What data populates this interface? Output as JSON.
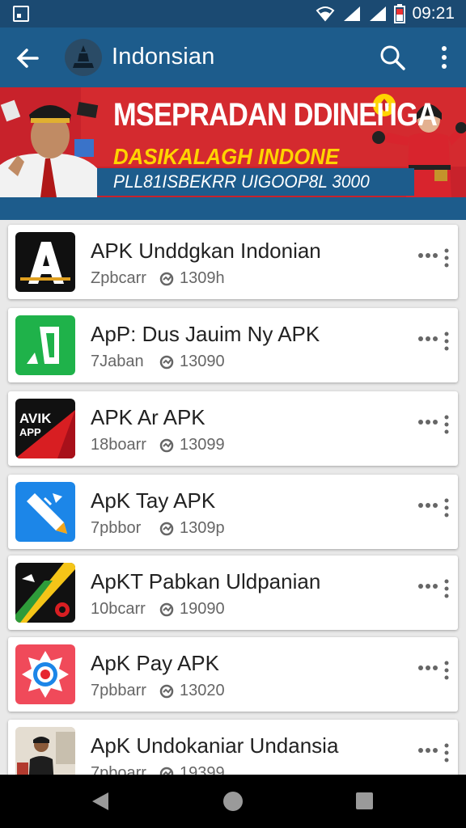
{
  "status_bar": {
    "time": "09:21",
    "icons": [
      "screen-cast-icon",
      "wifi-icon",
      "signal-icon",
      "signal-icon",
      "battery-icon"
    ]
  },
  "app_bar": {
    "title": "Indonsian",
    "icons": [
      "back-arrow-icon",
      "app-logo",
      "search-icon",
      "more-vert-icon"
    ]
  },
  "banner": {
    "line1": "MSEPRADAN DDINEI'IGA",
    "line2": "DASIKALAGH INDONE",
    "line3": "PLL81ISBEKRR UIGOOP8L 3000",
    "colors": {
      "background": "#c8222b",
      "strip": "#1d5c8c",
      "headline2": "#ffd400"
    }
  },
  "apps": [
    {
      "title": "APK Unddgkan Indonian",
      "subtitle": "Zpbcarr",
      "count": "1309h",
      "icon": "letter-a-icon"
    },
    {
      "title": "ApP: Dus Jauim Ny APK",
      "subtitle": "7Jaban",
      "count": "13090",
      "icon": "green-d-icon"
    },
    {
      "title": "APK Ar APK",
      "subtitle": "18boarr",
      "count": "13099",
      "icon": "red-avik-app-icon",
      "icon_text1": "AVIK",
      "icon_text2": "APP"
    },
    {
      "title": "ApK Tay APK",
      "subtitle": "7pbbor",
      "count": "1309p",
      "icon": "blue-pencil-icon"
    },
    {
      "title": "ApKT Pabkan Uldpanian",
      "subtitle": "10bcarr",
      "count": "19090",
      "icon": "green-yellow-stripe-icon"
    },
    {
      "title": "ApK Pay APK",
      "subtitle": "7pbbarr",
      "count": "13020",
      "icon": "target-icon"
    },
    {
      "title": "ApK Undokaniar Undansia",
      "subtitle": "7pboarr",
      "count": "19399",
      "icon": "person-photo-icon"
    }
  ],
  "nav": {
    "icons": [
      "nav-back-icon",
      "nav-home-icon",
      "nav-recents-icon"
    ]
  }
}
